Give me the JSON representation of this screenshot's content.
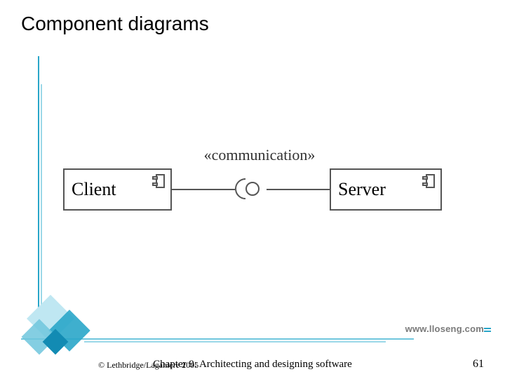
{
  "title": "Component diagrams",
  "diagram": {
    "client_label": "Client",
    "server_label": "Server",
    "interface_label": "«communication»"
  },
  "template": {
    "url": "www.lloseng.com"
  },
  "footer": {
    "copyright": "© Lethbridge/Laganière 2005",
    "chapter": "Chapter 9: Architecting and designing software",
    "page": "61"
  }
}
